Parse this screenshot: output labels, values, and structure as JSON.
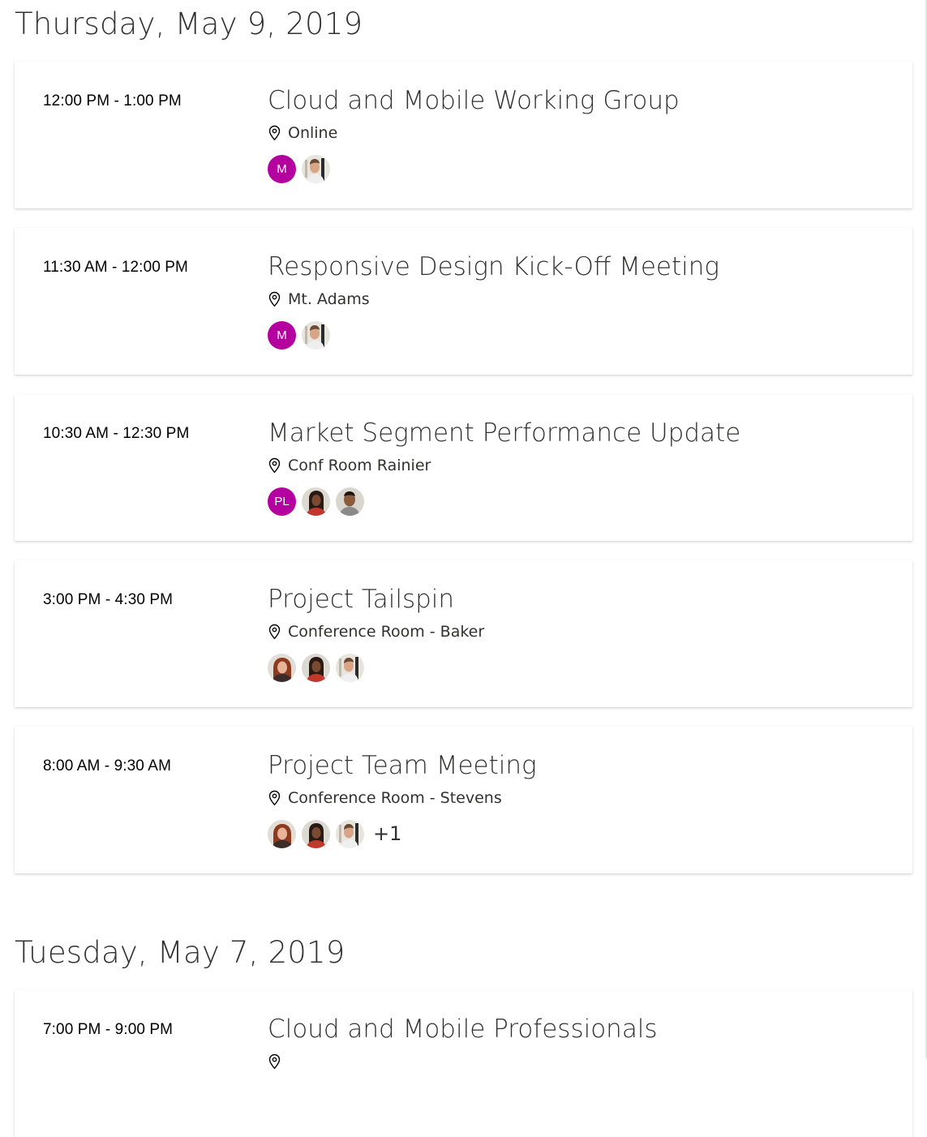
{
  "days": [
    {
      "header": "Thursday, May 9, 2019",
      "events": [
        {
          "time": "12:00 PM - 1:00 PM",
          "subject": "Cloud and Mobile Working Group",
          "location": "Online",
          "attendees": [
            {
              "type": "initials",
              "initials": "M"
            },
            {
              "type": "photo",
              "photo": "man-photo"
            }
          ],
          "overflow": ""
        },
        {
          "time": "11:30 AM - 12:00 PM",
          "subject": "Responsive Design Kick-Off Meeting",
          "location": "Mt. Adams",
          "attendees": [
            {
              "type": "initials",
              "initials": "M"
            },
            {
              "type": "photo",
              "photo": "man-photo"
            }
          ],
          "overflow": ""
        },
        {
          "time": "10:30 AM - 12:30 PM",
          "subject": "Market Segment Performance Update",
          "location": "Conf Room Rainier",
          "attendees": [
            {
              "type": "initials",
              "initials": "PL"
            },
            {
              "type": "photo",
              "photo": "woman-dark-hair-photo"
            },
            {
              "type": "photo",
              "photo": "man-dark-photo"
            }
          ],
          "overflow": ""
        },
        {
          "time": "3:00 PM - 4:30 PM",
          "subject": "Project Tailspin",
          "location": "Conference Room - Baker",
          "attendees": [
            {
              "type": "photo",
              "photo": "woman-red-hair-photo"
            },
            {
              "type": "photo",
              "photo": "woman-dark-hair-photo"
            },
            {
              "type": "photo",
              "photo": "man-photo"
            }
          ],
          "overflow": ""
        },
        {
          "time": "8:00 AM - 9:30 AM",
          "subject": "Project Team Meeting",
          "location": "Conference Room - Stevens",
          "attendees": [
            {
              "type": "photo",
              "photo": "woman-red-hair-photo"
            },
            {
              "type": "photo",
              "photo": "woman-dark-hair-photo"
            },
            {
              "type": "photo",
              "photo": "man-photo"
            }
          ],
          "overflow": "+1"
        }
      ]
    },
    {
      "header": "Tuesday, May 7, 2019",
      "events": [
        {
          "time": "7:00 PM - 9:00 PM",
          "subject": "Cloud and Mobile Professionals",
          "location": "",
          "attendees": [],
          "overflow": ""
        }
      ]
    }
  ],
  "colors": {
    "initials_avatar_bg": "#b4009e",
    "text": "#323130"
  }
}
